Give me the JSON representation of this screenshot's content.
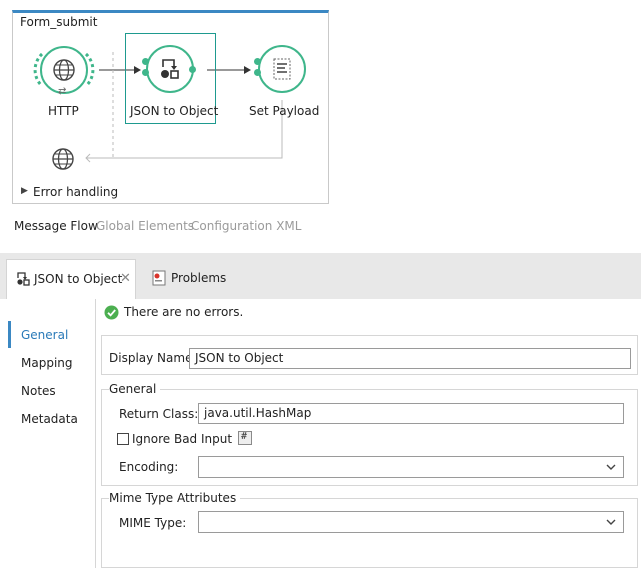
{
  "flow": {
    "title": "Form_submit",
    "nodes": {
      "http": "HTTP",
      "json_to_object": "JSON to Object",
      "set_payload": "Set Payload"
    },
    "error_handling": "Error handling"
  },
  "view_tabs": {
    "message_flow": "Message Flow",
    "global_elements": "Global Elements",
    "configuration_xml": "Configuration XML"
  },
  "panel_tabs": {
    "active": "JSON to Object",
    "problems": "Problems"
  },
  "status": {
    "message": "There are no errors."
  },
  "side_nav": [
    "General",
    "Mapping",
    "Notes",
    "Metadata"
  ],
  "form": {
    "display_name_label": "Display Name:",
    "display_name_value": "JSON to Object",
    "general_group": "General",
    "return_class_label": "Return Class:",
    "return_class_value": "java.util.HashMap",
    "ignore_bad_input_label": "Ignore Bad Input",
    "ignore_bad_input_checked": false,
    "encoding_label": "Encoding:",
    "encoding_value": "",
    "mime_group": "Mime Type Attributes",
    "mime_type_label": "MIME Type:",
    "mime_type_value": ""
  },
  "colors": {
    "accent": "#3b88c3",
    "node_green": "#3fb68b",
    "selection": "#1e9a8f",
    "muted_text": "#9a9a9a",
    "status_green": "#4caf50"
  }
}
